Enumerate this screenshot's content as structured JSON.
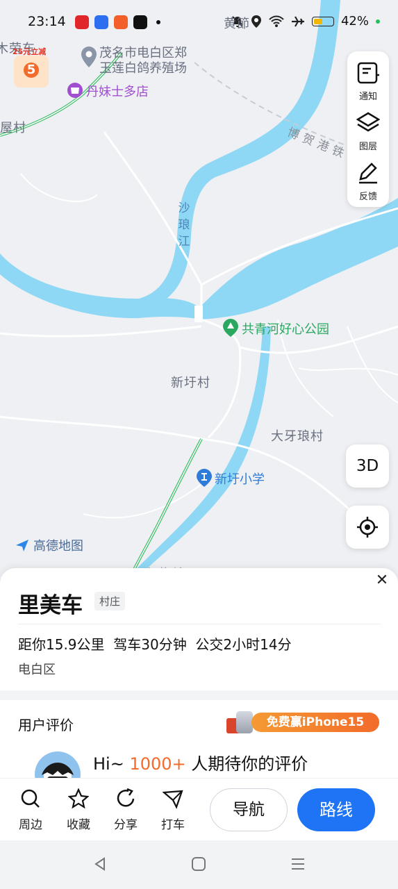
{
  "status_bar": {
    "time": "23:14",
    "battery": "42%",
    "app_icons": [
      "tmall-icon",
      "taobao-flash-icon",
      "meituan-icon",
      "douyin-icon"
    ],
    "right_icons": [
      "mute-icon",
      "location-icon",
      "wifi-icon",
      "airplane-icon",
      "battery-icon"
    ]
  },
  "map": {
    "labels": {
      "huangdian": "黄節",
      "rong_che": "木荣车",
      "wu_cun": "屋村",
      "poi_farm_line1": "茂名市电白区郑",
      "poi_farm_line2": "玉莲白鸽养殖场",
      "poi_shop": "丹妹士多店",
      "river": "沙琅江",
      "railway": "博贺港铁",
      "park": "共青河好心公园",
      "xinxu_village": "新圩村",
      "daya_village": "大牙琅村",
      "school": "新圩小学",
      "promo_badge": "25元立减",
      "promo_badge_num": "5",
      "amap_logo": "高德地图",
      "bottom_partial": "红梅岭"
    },
    "colors": {
      "land": "#eef0f3",
      "river": "#8fd8f5",
      "road": "#ffffff",
      "highway": "#3fbf6a",
      "poi_park": "#2aa860",
      "poi_shop": "#a04fd0",
      "poi_school": "#2f7bd8"
    }
  },
  "side_panel": {
    "notify": "通知",
    "layers": "图层",
    "feedback": "反馈",
    "three_d": "3D"
  },
  "place": {
    "name": "里美车",
    "tag": "村庄",
    "distance": "距你15.9公里",
    "drive": "驾车30分钟",
    "bus": "公交2小时14分",
    "district": "电白区"
  },
  "reviews": {
    "title": "用户评价",
    "promo": "免费赢iPhone15",
    "invite_prefix": "Hi~ ",
    "invite_count": "1000+",
    "invite_suffix": " 人期待你的评价"
  },
  "actions": {
    "nearby": "周边",
    "favorite": "收藏",
    "share": "分享",
    "taxi": "打车",
    "navigate": "导航",
    "route": "路线"
  },
  "system_nav": [
    "back-icon",
    "home-icon",
    "recents-icon"
  ]
}
